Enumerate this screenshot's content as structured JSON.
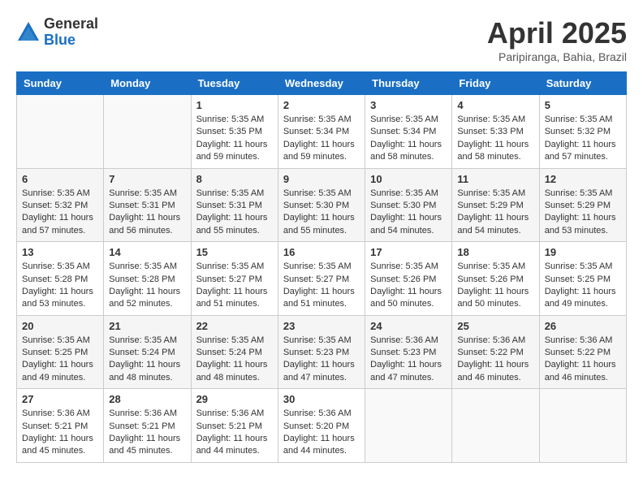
{
  "header": {
    "logo_general": "General",
    "logo_blue": "Blue",
    "month_title": "April 2025",
    "location": "Paripiranga, Bahia, Brazil"
  },
  "weekdays": [
    "Sunday",
    "Monday",
    "Tuesday",
    "Wednesday",
    "Thursday",
    "Friday",
    "Saturday"
  ],
  "weeks": [
    [
      {
        "day": "",
        "sunrise": "",
        "sunset": "",
        "daylight": ""
      },
      {
        "day": "",
        "sunrise": "",
        "sunset": "",
        "daylight": ""
      },
      {
        "day": "1",
        "sunrise": "Sunrise: 5:35 AM",
        "sunset": "Sunset: 5:35 PM",
        "daylight": "Daylight: 11 hours and 59 minutes."
      },
      {
        "day": "2",
        "sunrise": "Sunrise: 5:35 AM",
        "sunset": "Sunset: 5:34 PM",
        "daylight": "Daylight: 11 hours and 59 minutes."
      },
      {
        "day": "3",
        "sunrise": "Sunrise: 5:35 AM",
        "sunset": "Sunset: 5:34 PM",
        "daylight": "Daylight: 11 hours and 58 minutes."
      },
      {
        "day": "4",
        "sunrise": "Sunrise: 5:35 AM",
        "sunset": "Sunset: 5:33 PM",
        "daylight": "Daylight: 11 hours and 58 minutes."
      },
      {
        "day": "5",
        "sunrise": "Sunrise: 5:35 AM",
        "sunset": "Sunset: 5:32 PM",
        "daylight": "Daylight: 11 hours and 57 minutes."
      }
    ],
    [
      {
        "day": "6",
        "sunrise": "Sunrise: 5:35 AM",
        "sunset": "Sunset: 5:32 PM",
        "daylight": "Daylight: 11 hours and 57 minutes."
      },
      {
        "day": "7",
        "sunrise": "Sunrise: 5:35 AM",
        "sunset": "Sunset: 5:31 PM",
        "daylight": "Daylight: 11 hours and 56 minutes."
      },
      {
        "day": "8",
        "sunrise": "Sunrise: 5:35 AM",
        "sunset": "Sunset: 5:31 PM",
        "daylight": "Daylight: 11 hours and 55 minutes."
      },
      {
        "day": "9",
        "sunrise": "Sunrise: 5:35 AM",
        "sunset": "Sunset: 5:30 PM",
        "daylight": "Daylight: 11 hours and 55 minutes."
      },
      {
        "day": "10",
        "sunrise": "Sunrise: 5:35 AM",
        "sunset": "Sunset: 5:30 PM",
        "daylight": "Daylight: 11 hours and 54 minutes."
      },
      {
        "day": "11",
        "sunrise": "Sunrise: 5:35 AM",
        "sunset": "Sunset: 5:29 PM",
        "daylight": "Daylight: 11 hours and 54 minutes."
      },
      {
        "day": "12",
        "sunrise": "Sunrise: 5:35 AM",
        "sunset": "Sunset: 5:29 PM",
        "daylight": "Daylight: 11 hours and 53 minutes."
      }
    ],
    [
      {
        "day": "13",
        "sunrise": "Sunrise: 5:35 AM",
        "sunset": "Sunset: 5:28 PM",
        "daylight": "Daylight: 11 hours and 53 minutes."
      },
      {
        "day": "14",
        "sunrise": "Sunrise: 5:35 AM",
        "sunset": "Sunset: 5:28 PM",
        "daylight": "Daylight: 11 hours and 52 minutes."
      },
      {
        "day": "15",
        "sunrise": "Sunrise: 5:35 AM",
        "sunset": "Sunset: 5:27 PM",
        "daylight": "Daylight: 11 hours and 51 minutes."
      },
      {
        "day": "16",
        "sunrise": "Sunrise: 5:35 AM",
        "sunset": "Sunset: 5:27 PM",
        "daylight": "Daylight: 11 hours and 51 minutes."
      },
      {
        "day": "17",
        "sunrise": "Sunrise: 5:35 AM",
        "sunset": "Sunset: 5:26 PM",
        "daylight": "Daylight: 11 hours and 50 minutes."
      },
      {
        "day": "18",
        "sunrise": "Sunrise: 5:35 AM",
        "sunset": "Sunset: 5:26 PM",
        "daylight": "Daylight: 11 hours and 50 minutes."
      },
      {
        "day": "19",
        "sunrise": "Sunrise: 5:35 AM",
        "sunset": "Sunset: 5:25 PM",
        "daylight": "Daylight: 11 hours and 49 minutes."
      }
    ],
    [
      {
        "day": "20",
        "sunrise": "Sunrise: 5:35 AM",
        "sunset": "Sunset: 5:25 PM",
        "daylight": "Daylight: 11 hours and 49 minutes."
      },
      {
        "day": "21",
        "sunrise": "Sunrise: 5:35 AM",
        "sunset": "Sunset: 5:24 PM",
        "daylight": "Daylight: 11 hours and 48 minutes."
      },
      {
        "day": "22",
        "sunrise": "Sunrise: 5:35 AM",
        "sunset": "Sunset: 5:24 PM",
        "daylight": "Daylight: 11 hours and 48 minutes."
      },
      {
        "day": "23",
        "sunrise": "Sunrise: 5:35 AM",
        "sunset": "Sunset: 5:23 PM",
        "daylight": "Daylight: 11 hours and 47 minutes."
      },
      {
        "day": "24",
        "sunrise": "Sunrise: 5:36 AM",
        "sunset": "Sunset: 5:23 PM",
        "daylight": "Daylight: 11 hours and 47 minutes."
      },
      {
        "day": "25",
        "sunrise": "Sunrise: 5:36 AM",
        "sunset": "Sunset: 5:22 PM",
        "daylight": "Daylight: 11 hours and 46 minutes."
      },
      {
        "day": "26",
        "sunrise": "Sunrise: 5:36 AM",
        "sunset": "Sunset: 5:22 PM",
        "daylight": "Daylight: 11 hours and 46 minutes."
      }
    ],
    [
      {
        "day": "27",
        "sunrise": "Sunrise: 5:36 AM",
        "sunset": "Sunset: 5:21 PM",
        "daylight": "Daylight: 11 hours and 45 minutes."
      },
      {
        "day": "28",
        "sunrise": "Sunrise: 5:36 AM",
        "sunset": "Sunset: 5:21 PM",
        "daylight": "Daylight: 11 hours and 45 minutes."
      },
      {
        "day": "29",
        "sunrise": "Sunrise: 5:36 AM",
        "sunset": "Sunset: 5:21 PM",
        "daylight": "Daylight: 11 hours and 44 minutes."
      },
      {
        "day": "30",
        "sunrise": "Sunrise: 5:36 AM",
        "sunset": "Sunset: 5:20 PM",
        "daylight": "Daylight: 11 hours and 44 minutes."
      },
      {
        "day": "",
        "sunrise": "",
        "sunset": "",
        "daylight": ""
      },
      {
        "day": "",
        "sunrise": "",
        "sunset": "",
        "daylight": ""
      },
      {
        "day": "",
        "sunrise": "",
        "sunset": "",
        "daylight": ""
      }
    ]
  ]
}
